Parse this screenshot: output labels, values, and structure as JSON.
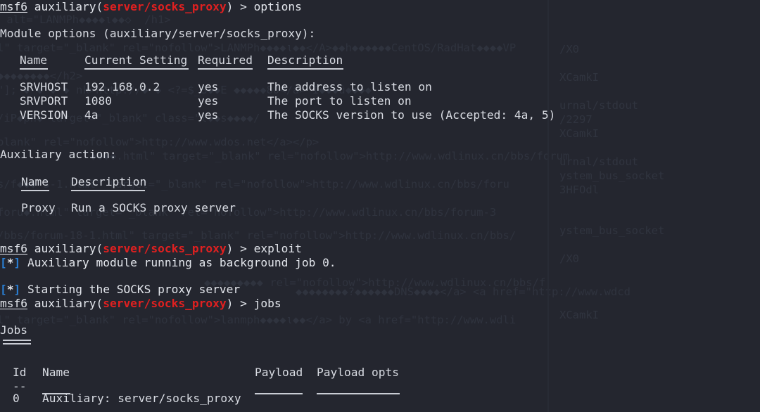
{
  "terminal": {
    "app": "msfconsole",
    "background_color": "#24262f",
    "foreground_color": "#d8dbe2",
    "prompt_module_color": "#e02020",
    "info_marker_color": "#2a7fd4",
    "font_size_px": 16,
    "line_height_px": 20
  },
  "prompts": {
    "shell": "msf6",
    "context_prefix": "auxiliary(",
    "module": "server/socks_proxy",
    "context_suffix": ")",
    "arrow": ">",
    "command_options": "options",
    "command_exploit": "exploit",
    "command_jobs": "jobs"
  },
  "module_options": {
    "heading": "Module options (auxiliary/server/socks_proxy):",
    "columns": [
      "Name",
      "Current Setting",
      "Required",
      "Description"
    ],
    "rows": [
      {
        "name": "SRVHOST",
        "current_setting": "192.168.0.2",
        "required": "yes",
        "description": "The address to listen on"
      },
      {
        "name": "SRVPORT",
        "current_setting": "1080",
        "required": "yes",
        "description": "The port to listen on"
      },
      {
        "name": "VERSION",
        "current_setting": "4a",
        "required": "yes",
        "description": "The SOCKS version to use (Accepted: 4a, 5)"
      }
    ]
  },
  "auxiliary_action": {
    "heading": "Auxiliary action:",
    "columns": [
      "Name",
      "Description"
    ],
    "rows": [
      {
        "name": "Proxy",
        "description": "Run a SOCKS proxy server"
      }
    ]
  },
  "messages": {
    "marker_open": "[",
    "marker_star": "*",
    "marker_close": "]",
    "background_job": "Auxiliary module running as background job 0.",
    "starting_proxy": "Starting the SOCKS proxy server"
  },
  "jobs": {
    "title": "Jobs",
    "title_rule": "====",
    "columns": [
      "Id",
      "Name",
      "Payload",
      "Payload opts"
    ],
    "id_dashes": "--",
    "rows": [
      {
        "id": "0",
        "name": "Auxiliary: server/socks_proxy",
        "payload": "",
        "payload_opts": ""
      }
    ]
  },
  "background_bleed": {
    "left_lines": [
      " alt=\"LANMPh◆◆◆◆ι◆◆◇  /h1>",
      "l\" target=\"_blank\" rel=\"nofollow\">LANMPh◆◆◆◆ι◆◆</A>◆◆h◆◆◆◆◆◆CentOS/RadHat◆◆◆◆VP",
      "◆◆◆◆◆◆◆◆</h2>",
      "\"]; ◆ ◆ ◆ ◆ nk>http://◆ ◆ <?=$_S◆◆E ◆◆◆◆◆80</a> Ï◆◆◆û◆◆◆◆",
      "/iP◆ph◆ target=\"_blank\" class=\"l◆◆s◆◆◆◆/",
      "blank\" rel=\"nofollow\">http://www.wdos.net</a></p>",
      "◆◆◆◆.html\" target=\"_blank\" rel=\"nofollow\">http://www.wdlinux.cn/bbs/forum",
      "s/f◆◆◆-5-1.html\" target=\"_blank\" rel=\"nofollow\">http://www.wdlinux.cn/bbs/foru",
      "foru◆.html\" target=\"_blank\" rel=\"nofollow\">http://www.wdlinux.cn/bbs/forum-3",
      "/bbs/forum-18-1.html\" target=\"_blank\" rel=\"nofollow\">http://www.wdlinux.cn/bbs/",
      "◆◆◆◆◆◆◆◆◆ rel=\"nofollow\">http://www.wdlinux.cn/bbs/f",
      "◆◆◆◆◆◆◆◆?◆◆◆◆◆◆DNS◆◆◆◆</a> <a href=\"http://www.wdcd",
      "l\" target=\"_blank\" rel=\"nofollow\">lanmph◆◆◆◆ι◆◆</a> by <a href=\"http://www.wdli"
    ],
    "right_lines": [
      "/X0",
      "XCamkI",
      "urnal/stdout",
      "/2297",
      "XCamkI",
      "urnal/stdout",
      "ystem_bus_socket",
      "3HFOdl",
      "ystem_bus_socket",
      "/X0",
      "XCamkI"
    ]
  }
}
